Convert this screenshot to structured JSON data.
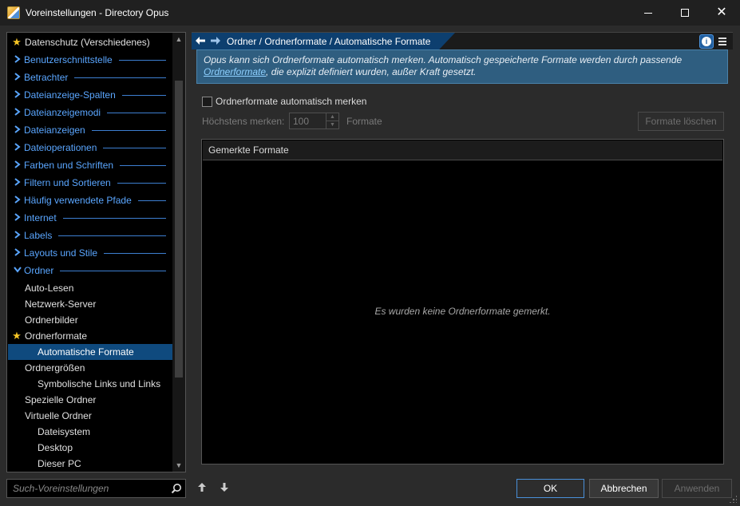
{
  "window": {
    "title": "Voreinstellungen - Directory Opus",
    "minimize_icon": "minimize-icon",
    "maximize_icon": "maximize-icon",
    "close_glyph": "✕"
  },
  "tree": {
    "items": [
      {
        "label": "Datenschutz (Verschiedenes)",
        "kind": "starred-cat"
      },
      {
        "label": "Benutzerschnittstelle",
        "kind": "cat"
      },
      {
        "label": "Betrachter",
        "kind": "cat"
      },
      {
        "label": "Dateianzeige-Spalten",
        "kind": "cat"
      },
      {
        "label": "Dateianzeigemodi",
        "kind": "cat"
      },
      {
        "label": "Dateianzeigen",
        "kind": "cat"
      },
      {
        "label": "Dateioperationen",
        "kind": "cat"
      },
      {
        "label": "Farben und Schriften",
        "kind": "cat"
      },
      {
        "label": "Filtern und Sortieren",
        "kind": "cat"
      },
      {
        "label": "Häufig verwendete Pfade",
        "kind": "cat"
      },
      {
        "label": "Internet",
        "kind": "cat"
      },
      {
        "label": "Labels",
        "kind": "cat"
      },
      {
        "label": "Layouts und Stile",
        "kind": "cat"
      },
      {
        "label": "Ordner",
        "kind": "cat-open"
      },
      {
        "label": "Auto-Lesen",
        "kind": "sub"
      },
      {
        "label": "Netzwerk-Server",
        "kind": "sub"
      },
      {
        "label": "Ordnerbilder",
        "kind": "sub"
      },
      {
        "label": "Ordnerformate",
        "kind": "starred-sub"
      },
      {
        "label": "Automatische Formate",
        "kind": "sub2-selected"
      },
      {
        "label": "Ordnergrößen",
        "kind": "sub"
      },
      {
        "label": "Symbolische Links und Links",
        "kind": "sub2"
      },
      {
        "label": "Spezielle Ordner",
        "kind": "sub"
      },
      {
        "label": "Virtuelle Ordner",
        "kind": "sub"
      },
      {
        "label": "Dateisystem",
        "kind": "sub2"
      },
      {
        "label": "Desktop",
        "kind": "sub2"
      },
      {
        "label": "Dieser PC",
        "kind": "sub2"
      }
    ]
  },
  "search": {
    "placeholder": "Such-Voreinstellungen",
    "icon": "search-icon"
  },
  "header": {
    "breadcrumb": "Ordner / Ordnerformate / Automatische Formate",
    "back_glyph": "🡐",
    "forward_glyph": "🡒"
  },
  "info": {
    "text_before": "Opus kann sich Ordnerformate automatisch merken. Automatisch gespeicherte Formate werden durch passende ",
    "link": "Ordnerformate",
    "text_after": ", die explizit definiert wurden, außer Kraft gesetzt."
  },
  "form": {
    "checkbox_label": "Ordnerformate automatisch merken",
    "checkbox_checked": false,
    "max_label": "Höchstens merken:",
    "max_value": "100",
    "unit_label": "Formate",
    "delete_button": "Formate löschen"
  },
  "list": {
    "header": "Gemerkte Formate",
    "empty_text": "Es wurden keine Ordnerformate gemerkt."
  },
  "footer": {
    "ok": "OK",
    "cancel": "Abbrechen",
    "apply": "Anwenden"
  },
  "colors": {
    "accent": "#5aa6ff",
    "selection": "#0f4a7e",
    "info_bg": "#2f5e80"
  }
}
